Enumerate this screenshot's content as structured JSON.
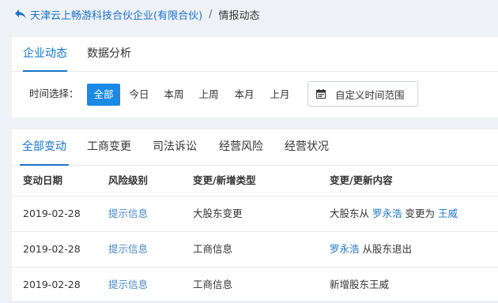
{
  "breadcrumb": {
    "company": "天津云上畅游科技合伙企业(有限合伙)",
    "separator": "/",
    "current": "情报动态"
  },
  "main_tabs": [
    {
      "label": "企业动态",
      "active": true
    },
    {
      "label": "数据分析",
      "active": false
    }
  ],
  "filter": {
    "label": "时间选择：",
    "options": [
      {
        "label": "全部",
        "active": true
      },
      {
        "label": "今日",
        "active": false
      },
      {
        "label": "本周",
        "active": false
      },
      {
        "label": "上周",
        "active": false
      },
      {
        "label": "本月",
        "active": false
      },
      {
        "label": "上月",
        "active": false
      }
    ],
    "custom_range_label": "自定义时间范围"
  },
  "change_tabs": [
    {
      "label": "全部变动",
      "active": true
    },
    {
      "label": "工商变更",
      "active": false
    },
    {
      "label": "司法诉讼",
      "active": false
    },
    {
      "label": "经营风险",
      "active": false
    },
    {
      "label": "经营状况",
      "active": false
    }
  ],
  "table": {
    "columns": [
      "变动日期",
      "风险级别",
      "变更/新增类型",
      "变更/更新内容"
    ],
    "rows": [
      {
        "date": "2019-02-28",
        "risk": "提示信息",
        "type": "大股东变更",
        "content": {
          "prefix": "大股东从",
          "from": "罗永浩",
          "middle": "变更为",
          "to": "王威"
        }
      },
      {
        "date": "2019-02-28",
        "risk": "提示信息",
        "type": "工商信息",
        "content": {
          "link": "罗永浩",
          "suffix": "从股东退出"
        }
      },
      {
        "date": "2019-02-28",
        "risk": "提示信息",
        "type": "工商信息",
        "content": {
          "text": "新增股东王威"
        }
      }
    ]
  },
  "colors": {
    "accent": "#1a73c8",
    "active_button_bg": "#1a8ae6",
    "risk_text": "#4a86c5",
    "page_bg": "#eef1f5"
  },
  "icons": {
    "back": "back-arrow-icon",
    "calendar": "calendar-icon"
  }
}
